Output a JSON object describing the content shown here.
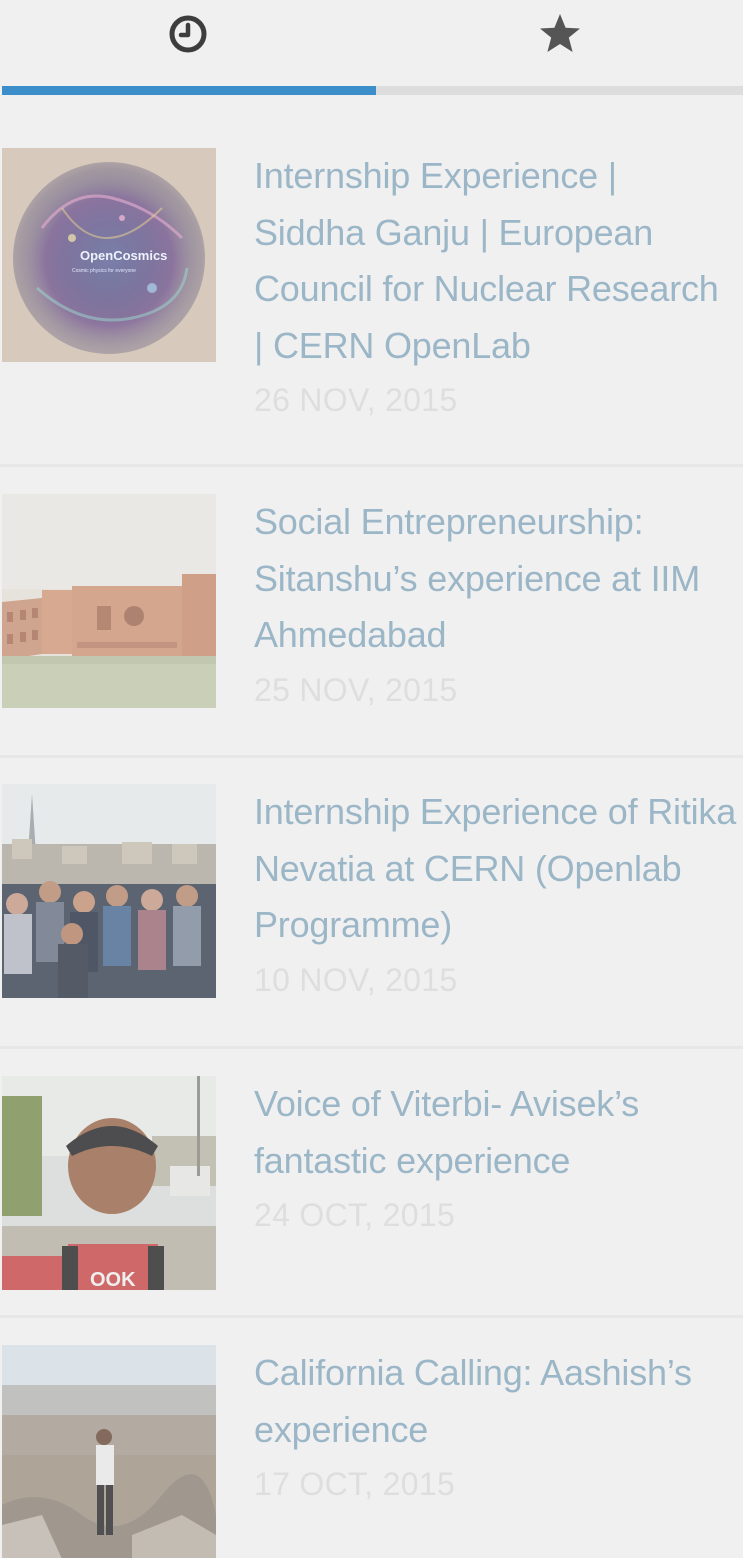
{
  "tabs": [
    {
      "name": "recent",
      "icon": "clock-icon",
      "active": true
    },
    {
      "name": "popular",
      "icon": "star-icon",
      "active": false
    }
  ],
  "colors": {
    "accent": "#3b8ec9",
    "title": "#9bb6c7",
    "date": "#dedede",
    "background": "#f0f0f0"
  },
  "posts": [
    {
      "title": "Internship Experience | Siddha Ganju | European Council for Nuclear Research | CERN OpenLab",
      "date": "26 NOV, 2015",
      "thumb_text": "OpenCosmics",
      "thumb_subtext": "Cosmic physics for everyone"
    },
    {
      "title": "Social Entrepreneurship: Sitanshu’s experience at IIM Ahmedabad",
      "date": "25 NOV, 2015"
    },
    {
      "title": "Internship Experience of Ritika Nevatia at CERN (Openlab Programme)",
      "date": "10 NOV, 2015"
    },
    {
      "title": "Voice of Viterbi- Avisek’s fantastic experience",
      "date": "24 OCT, 2015",
      "thumb_text": "OOK"
    },
    {
      "title": "California Calling: Aashish’s experience",
      "date": "17 OCT, 2015"
    }
  ]
}
